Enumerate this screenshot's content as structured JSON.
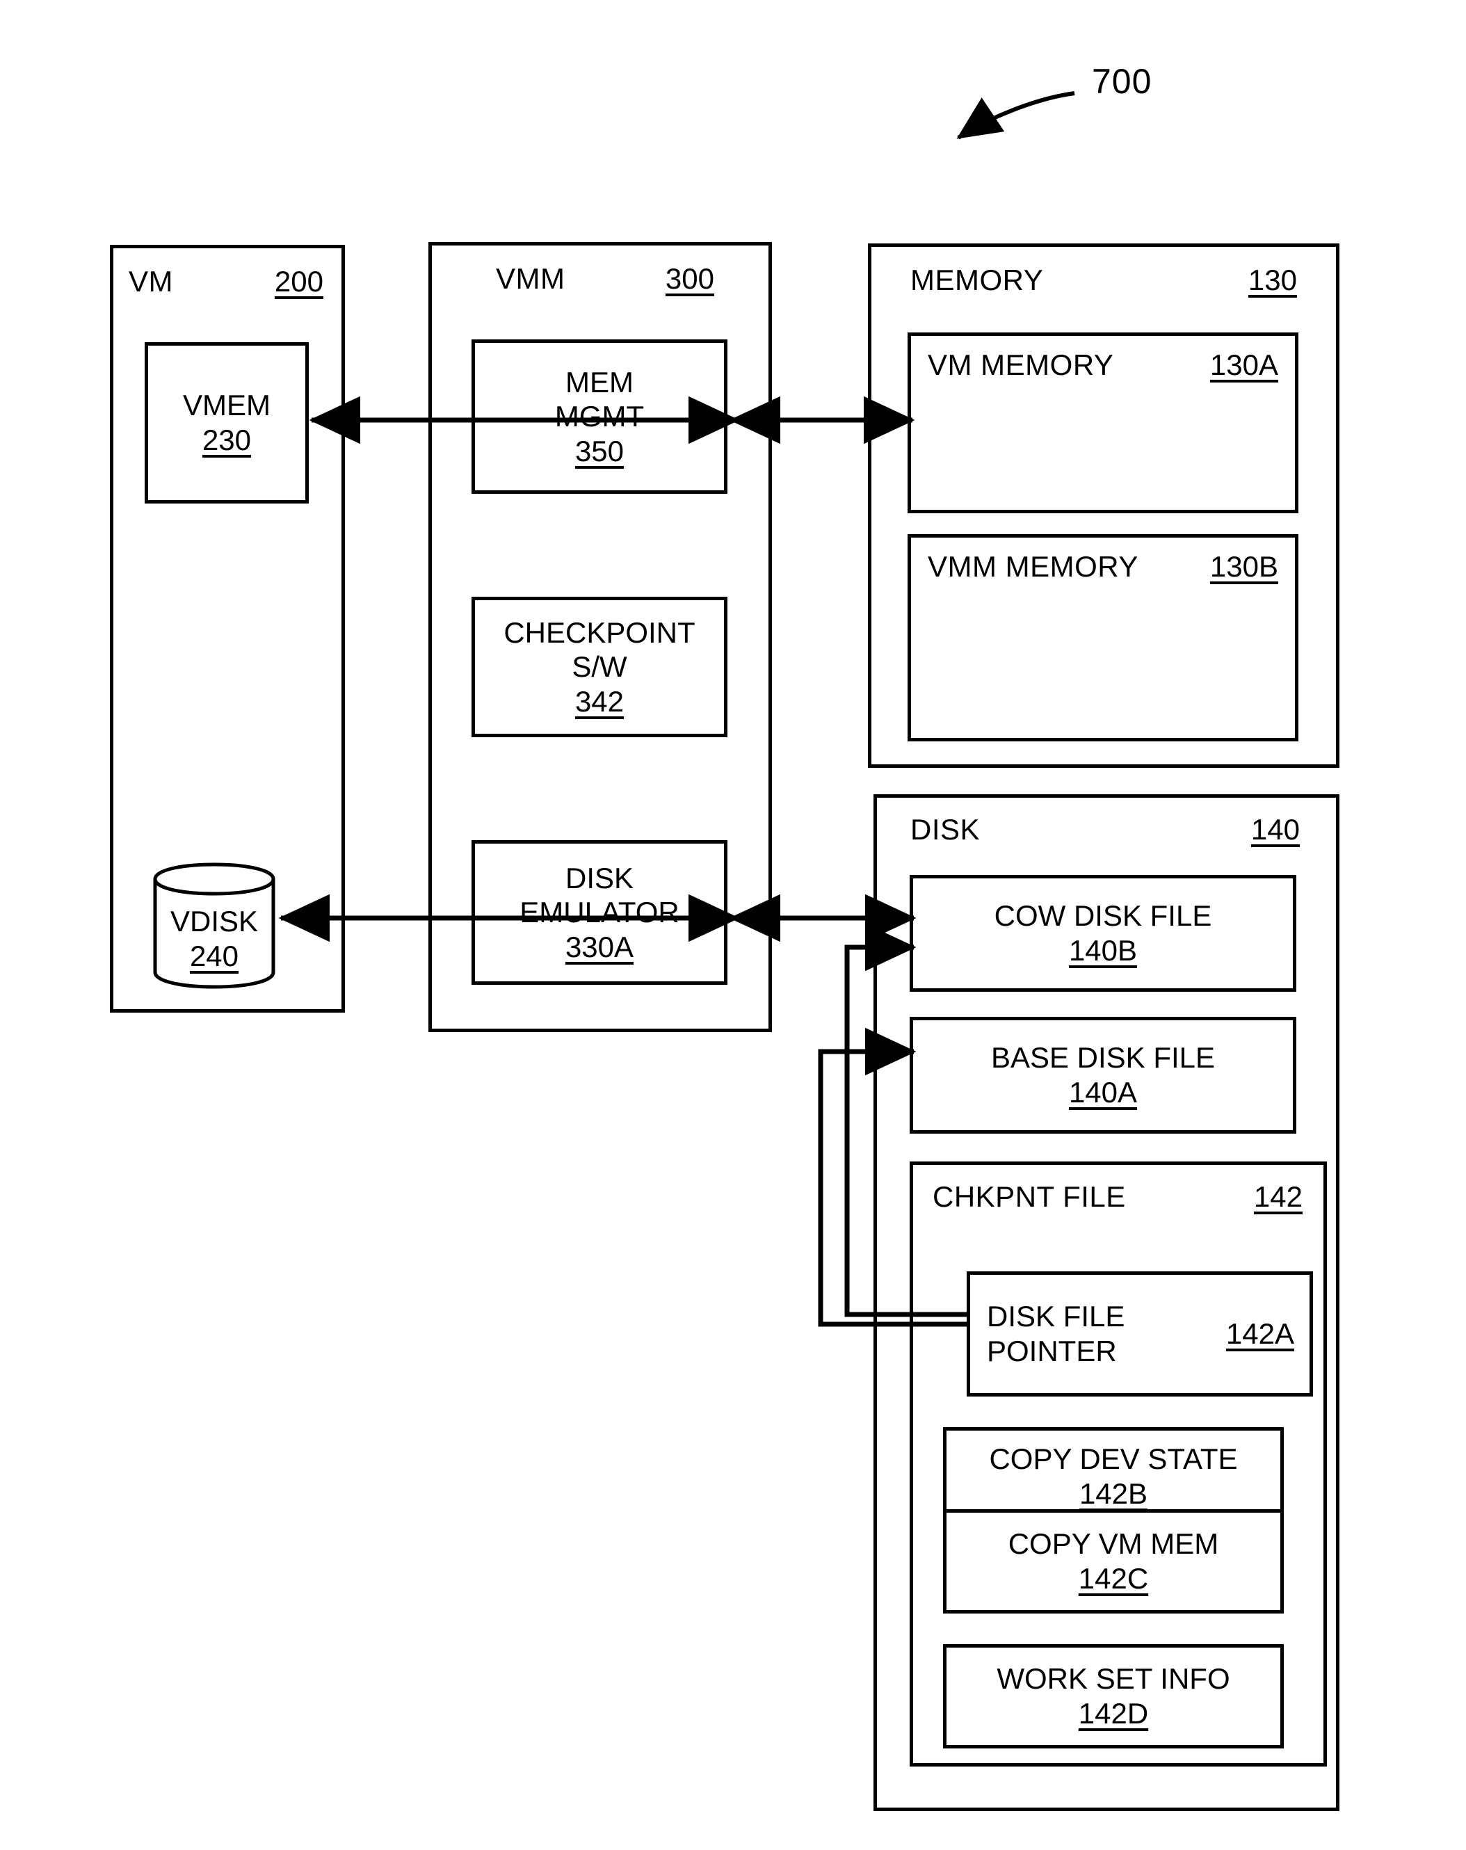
{
  "figure": {
    "number": "700",
    "callout_icon": "curved-arrow-icon"
  },
  "vm": {
    "name": "VM",
    "ref": "200",
    "vmem": {
      "name": "VMEM",
      "ref": "230"
    },
    "vdisk": {
      "name": "VDISK",
      "ref": "240",
      "icon": "cylinder-database-icon"
    }
  },
  "vmm": {
    "name": "VMM",
    "ref": "300",
    "mem_mgmt": {
      "line1": "MEM",
      "line2": "MGMT",
      "ref": "350"
    },
    "checkpoint_sw": {
      "line1": "CHECKPOINT",
      "line2": "S/W",
      "ref": "342"
    },
    "disk_emulator": {
      "line1": "DISK",
      "line2": "EMULATOR",
      "ref": "330A"
    }
  },
  "memory": {
    "name": "MEMORY",
    "ref": "130",
    "vm_memory": {
      "name": "VM MEMORY",
      "ref": "130A"
    },
    "vmm_memory": {
      "name": "VMM MEMORY",
      "ref": "130B"
    }
  },
  "disk": {
    "name": "DISK",
    "ref": "140",
    "cow_disk_file": {
      "name": "COW DISK FILE",
      "ref": "140B"
    },
    "base_disk_file": {
      "name": "BASE DISK FILE",
      "ref": "140A"
    },
    "chkpnt_file": {
      "name": "CHKPNT FILE",
      "ref": "142",
      "disk_file_pointer": {
        "line1": "DISK FILE",
        "line2": "POINTER",
        "ref": "142A"
      },
      "copy_dev_state": {
        "name": "COPY DEV STATE",
        "ref": "142B"
      },
      "copy_vm_mem": {
        "name": "COPY VM MEM",
        "ref": "142C"
      },
      "work_set_info": {
        "name": "WORK SET INFO",
        "ref": "142D"
      }
    }
  },
  "connectors": [
    {
      "name": "vmem-to-mem-mgmt",
      "style": "double-arrow"
    },
    {
      "name": "mem-mgmt-to-vm-memory",
      "style": "double-arrow"
    },
    {
      "name": "vdisk-to-disk-emulator",
      "style": "double-arrow"
    },
    {
      "name": "disk-emulator-to-cow-disk-file",
      "style": "double-arrow"
    },
    {
      "name": "disk-file-pointer-to-cow-disk-file",
      "style": "single-arrow"
    },
    {
      "name": "disk-file-pointer-to-base-disk-file",
      "style": "single-arrow"
    }
  ]
}
